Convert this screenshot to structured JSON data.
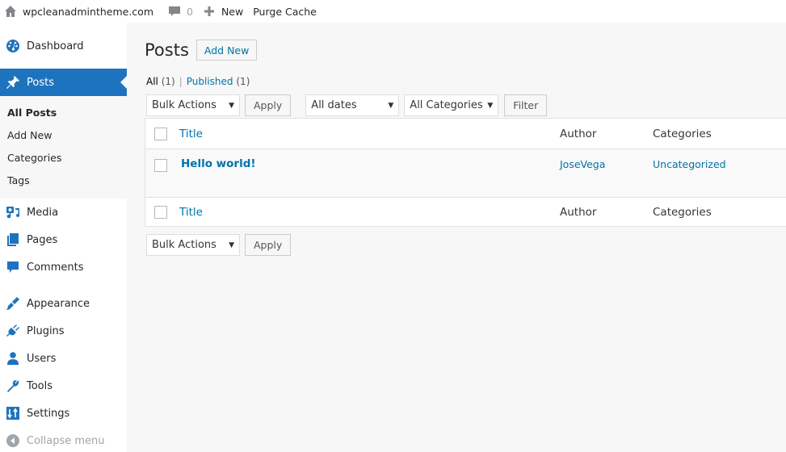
{
  "adminbar": {
    "site_name": "wpcleanadmintheme.com",
    "comments_count": "0",
    "new_label": "New",
    "purge_cache_label": "Purge Cache"
  },
  "sidebar": {
    "items": [
      {
        "label": "Dashboard",
        "icon": "dashboard-icon"
      },
      {
        "label": "Posts",
        "icon": "pin-icon",
        "active": true
      },
      {
        "label": "Media",
        "icon": "media-icon"
      },
      {
        "label": "Pages",
        "icon": "pages-icon"
      },
      {
        "label": "Comments",
        "icon": "comments-icon"
      },
      {
        "label": "Appearance",
        "icon": "brush-icon"
      },
      {
        "label": "Plugins",
        "icon": "plug-icon"
      },
      {
        "label": "Users",
        "icon": "user-icon"
      },
      {
        "label": "Tools",
        "icon": "wrench-icon"
      },
      {
        "label": "Settings",
        "icon": "settings-sliders-icon"
      }
    ],
    "posts_submenu": [
      "All Posts",
      "Add New",
      "Categories",
      "Tags"
    ],
    "collapse_label": "Collapse menu"
  },
  "main": {
    "title": "Posts",
    "add_new_label": "Add New",
    "views": {
      "all_label": "All",
      "all_count": "(1)",
      "separator": "|",
      "published_label": "Published",
      "published_count": "(1)"
    },
    "tablenav_top": {
      "bulk_actions": "Bulk Actions",
      "apply": "Apply",
      "dates": "All dates",
      "categories": "All Categories",
      "filter": "Filter"
    },
    "tablenav_bottom": {
      "bulk_actions": "Bulk Actions",
      "apply": "Apply"
    },
    "table": {
      "columns": [
        "Title",
        "Author",
        "Categories"
      ],
      "rows": [
        {
          "title": "Hello world!",
          "author": "JoseVega",
          "categories": "Uncategorized"
        }
      ]
    }
  },
  "colors": {
    "accent": "#1e73be",
    "link": "#0073aa",
    "background": "#f7f7f7"
  }
}
